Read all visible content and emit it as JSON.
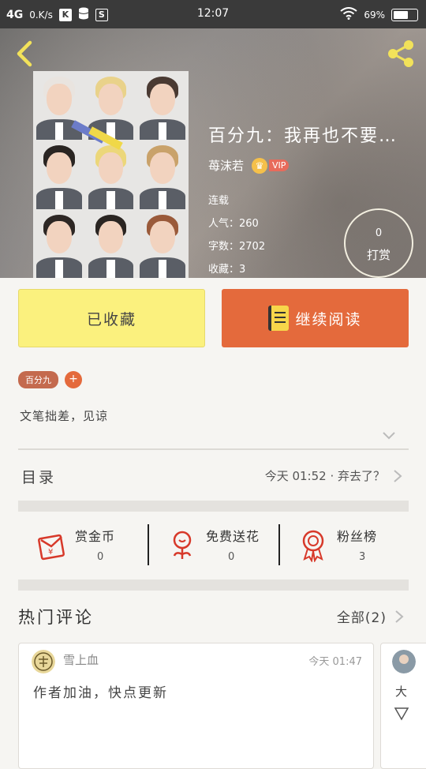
{
  "status_bar": {
    "network": "4G",
    "speed": "0.K/s",
    "time": "12:07",
    "battery": "69%",
    "battery_level": 0.69
  },
  "book": {
    "title": "百分九：我再也不要…",
    "author": "苺沫若",
    "vip_label": "VIP",
    "status": "连载",
    "popularity": "人气：260",
    "word_count": "字数：2702",
    "favorites": "收藏：3",
    "tip_amount": "0",
    "tip_label": "打赏"
  },
  "actions": {
    "favorite_label": "已收藏",
    "read_label": "继续阅读"
  },
  "tags": [
    "百分九",
    "+"
  ],
  "summary": "文笔拙差，见谅",
  "toc": {
    "label": "目录",
    "latest": "今天 01:52 · 弃去了？"
  },
  "stats": [
    {
      "name": "赏金币",
      "value": "0"
    },
    {
      "name": "免费送花",
      "value": "0"
    },
    {
      "name": "粉丝榜",
      "value": "3"
    }
  ],
  "comments": {
    "header": "热门评论",
    "all_label": "全部(2)",
    "items": [
      {
        "user": "雪上血",
        "time": "今天 01:47",
        "text": "作者加油，快点更新"
      },
      {
        "user": "",
        "time": "",
        "text": "大"
      }
    ]
  },
  "colors": {
    "accent_orange": "#e46a3c",
    "favorite_yellow": "#fbf17e",
    "tag_brown": "#c46a4e"
  }
}
